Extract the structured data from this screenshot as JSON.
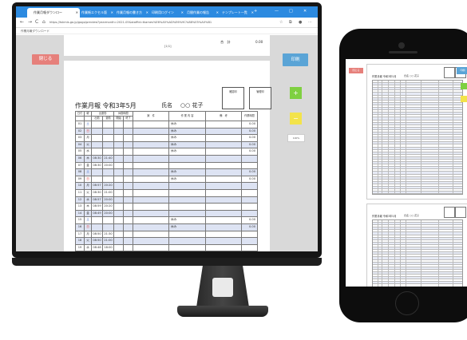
{
  "browser": {
    "tabs": [
      {
        "label": "作業月報ダウンロー",
        "active": true
      },
      {
        "label": "作業帳エクセル版",
        "active": false
      },
      {
        "label": "作業月報の書き方",
        "active": false
      },
      {
        "label": "印刷用ログイン",
        "active": false
      },
      {
        "label": "月間作業の報告",
        "active": false
      },
      {
        "label": "テンプレート一覧",
        "active": false
      }
    ],
    "new_tab_label": "+",
    "window_controls": [
      "—",
      "□",
      "✕"
    ],
    "nav": {
      "back": "←",
      "forward": "→",
      "reload": "C",
      "home": "⌂"
    },
    "url": "https://tskmis.go.jp/gogo/preview?yearmonth=2021-05&staffid=tkames%E6%A5%AD%E6%9C%88%E5%A0%B1",
    "bookmark": "作業月報ダウンロード"
  },
  "doc": {
    "page_indicator": "[1/1]",
    "total_label": "合　計",
    "total_value": "0.00",
    "close_label": "閉じる",
    "print_label": "印刷",
    "zoom_in": "+",
    "zoom_out": "−",
    "reset_label": "100%",
    "stamp1": "確認印",
    "stamp2": "管理印",
    "title": "作業月報 令和3年5月",
    "name_label": "氏名",
    "name_value": "○○ 花子",
    "headers": [
      "日付",
      "曜",
      "出退勤",
      "出勤",
      "退勤",
      "休憩時間",
      "開始",
      "終了",
      "案　件",
      "作 業 内 容",
      "備　考",
      "作業時間"
    ],
    "rows": [
      {
        "day": "01",
        "dow": "土",
        "in": "",
        "out": "",
        "task": "休み",
        "hours": "0.00"
      },
      {
        "day": "02",
        "dow": "日",
        "in": "",
        "out": "",
        "task": "休み",
        "hours": "0.00"
      },
      {
        "day": "03",
        "dow": "月",
        "in": "",
        "out": "",
        "task": "休み",
        "hours": "0.00"
      },
      {
        "day": "04",
        "dow": "火",
        "in": "",
        "out": "",
        "task": "休み",
        "hours": "0.00"
      },
      {
        "day": "05",
        "dow": "水",
        "in": "",
        "out": "",
        "task": "休み",
        "hours": "0.00"
      },
      {
        "day": "06",
        "dow": "木",
        "in": "08:30",
        "out": "21:40",
        "task": "",
        "hours": ""
      },
      {
        "day": "07",
        "dow": "金",
        "in": "08:30",
        "out": "20:00",
        "task": "",
        "hours": ""
      },
      {
        "day": "08",
        "dow": "土",
        "in": "",
        "out": "",
        "task": "休み",
        "hours": "0.00"
      },
      {
        "day": "09",
        "dow": "日",
        "in": "",
        "out": "",
        "task": "休み",
        "hours": "0.00"
      },
      {
        "day": "10",
        "dow": "月",
        "in": "08:57",
        "out": "20:20",
        "task": "",
        "hours": ""
      },
      {
        "day": "11",
        "dow": "火",
        "in": "08:30",
        "out": "21:00",
        "task": "",
        "hours": ""
      },
      {
        "day": "12",
        "dow": "水",
        "in": "08:57",
        "out": "20:00",
        "task": "",
        "hours": ""
      },
      {
        "day": "13",
        "dow": "木",
        "in": "08:59",
        "out": "20:20",
        "task": "",
        "hours": ""
      },
      {
        "day": "14",
        "dow": "金",
        "in": "08:49",
        "out": "20:00",
        "task": "",
        "hours": ""
      },
      {
        "day": "15",
        "dow": "土",
        "in": "",
        "out": "",
        "task": "休み",
        "hours": "0.00"
      },
      {
        "day": "16",
        "dow": "日",
        "in": "",
        "out": "",
        "task": "休み",
        "hours": "0.00"
      },
      {
        "day": "17",
        "dow": "月",
        "in": "08:50",
        "out": "21:30",
        "task": "",
        "hours": ""
      },
      {
        "day": "18",
        "dow": "火",
        "in": "08:50",
        "out": "21:00",
        "task": "",
        "hours": ""
      },
      {
        "day": "19",
        "dow": "水",
        "in": "08:48",
        "out": "18:00",
        "task": "",
        "hours": ""
      }
    ]
  },
  "mobile": {
    "close_label": "閉じる",
    "print_label": "印刷",
    "title": "作業月報 令和3年5月",
    "name": "氏名 ○○ 花子",
    "title2": "作業月報 令和3年5月",
    "name2": "氏名 ○○ 花子"
  },
  "colors": {
    "browser_accent": "#2c8ae0",
    "close": "#e6807b",
    "print": "#5aa4d6",
    "plus": "#7fd041",
    "minus": "#f3e34a",
    "row_alt": "#dde3f3"
  }
}
